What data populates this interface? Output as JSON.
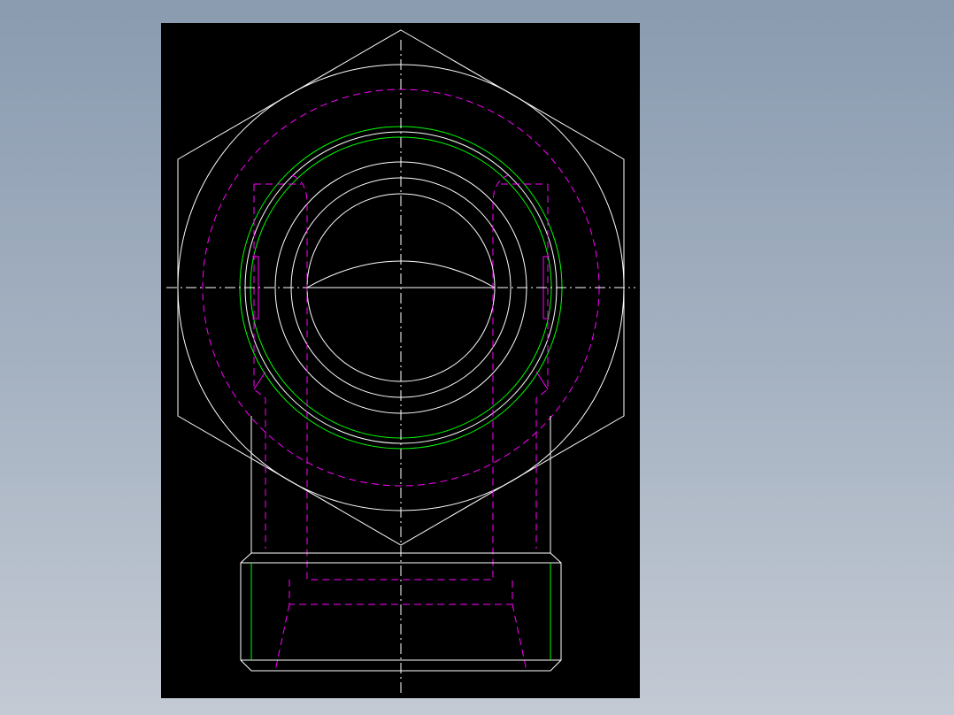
{
  "viewer": {
    "background_color": "#8a9bb0",
    "canvas_color": "#000000"
  },
  "drawing": {
    "line_colors": {
      "outline": "#ffffff",
      "hidden": "#ff00ff",
      "thread": "#00ff00",
      "centerline": "#ffffff"
    }
  }
}
